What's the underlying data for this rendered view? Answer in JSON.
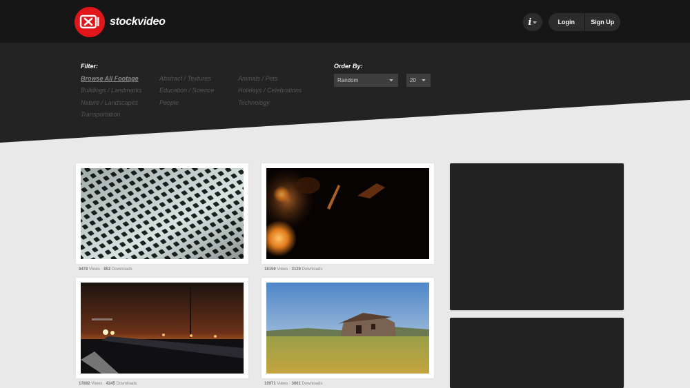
{
  "brand": {
    "name": "stockvideo",
    "logo_mark": "X",
    "accent": "#e0161b"
  },
  "header": {
    "info_label": "i",
    "login_label": "Login",
    "signup_label": "Sign Up"
  },
  "filter": {
    "label": "Filter:",
    "categories": [
      "Browse All Footage",
      "Abstract / Textures",
      "Animals / Pets",
      "Buildings / Landmarks",
      "Education / Science",
      "Holidays / Celebrations",
      "Nature / Landscapes",
      "People",
      "Technology",
      "Transportation"
    ],
    "active": "Browse All Footage"
  },
  "order": {
    "label": "Order By:",
    "sort_value": "Random",
    "count_value": "20"
  },
  "videos": [
    {
      "views": "8478",
      "views_label": "Views",
      "sep": "·",
      "downloads": "852",
      "downloads_label": "Downloads"
    },
    {
      "views": "18159",
      "views_label": "Views",
      "sep": "·",
      "downloads": "3129",
      "downloads_label": "Downloads"
    },
    {
      "views": "17892",
      "views_label": "Views",
      "sep": "·",
      "downloads": "4245",
      "downloads_label": "Downloads"
    },
    {
      "views": "10971",
      "views_label": "Views",
      "sep": "·",
      "downloads": "3661",
      "downloads_label": "Downloads"
    }
  ]
}
